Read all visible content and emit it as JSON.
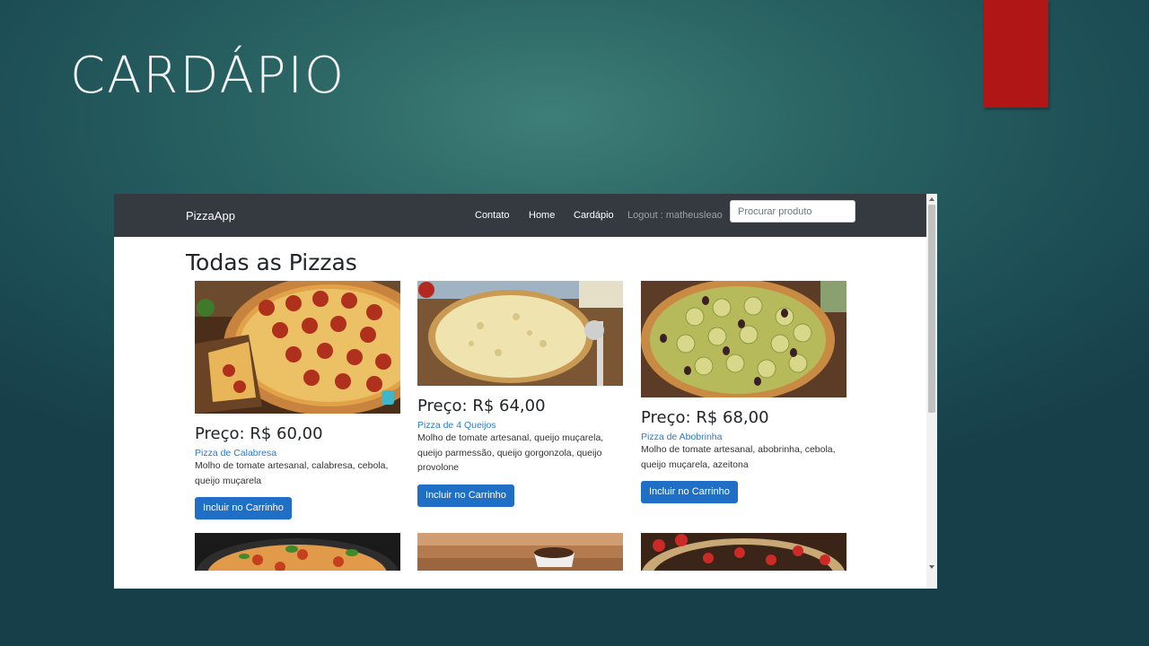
{
  "slide": {
    "title": "CARDÁPIO"
  },
  "navbar": {
    "brand": "PizzaApp",
    "links": [
      "Contato",
      "Home",
      "Cardápio"
    ],
    "logout": "Logout : matheusleao",
    "search_placeholder": "Procurar produto"
  },
  "page": {
    "heading": "Todas as Pizzas"
  },
  "products": [
    {
      "price": "Preço: R$ 60,00",
      "name": "Pizza de Calabresa",
      "description": "Molho de tomate artesanal, calabresa, cebola, queijo muçarela",
      "button": "Incluir no Carrinho"
    },
    {
      "price": "Preço: R$ 64,00",
      "name": "Pizza de 4 Queijos",
      "description": "Molho de tomate artesanal, queijo muçarela, queijo parmessão, queijo gorgonzola, queijo provolone",
      "button": "Incluir no Carrinho"
    },
    {
      "price": "Preço: R$ 68,00",
      "name": "Pizza de Abobrinha",
      "description": "Molho de tomate artesanal, abobrinha, cebola, queijo muçarela, azeitona",
      "button": "Incluir no Carrinho"
    }
  ],
  "colors": {
    "accent_red": "#b01616",
    "navbar": "#343a40",
    "button": "#1f6fc6",
    "link": "#2a79c9"
  }
}
